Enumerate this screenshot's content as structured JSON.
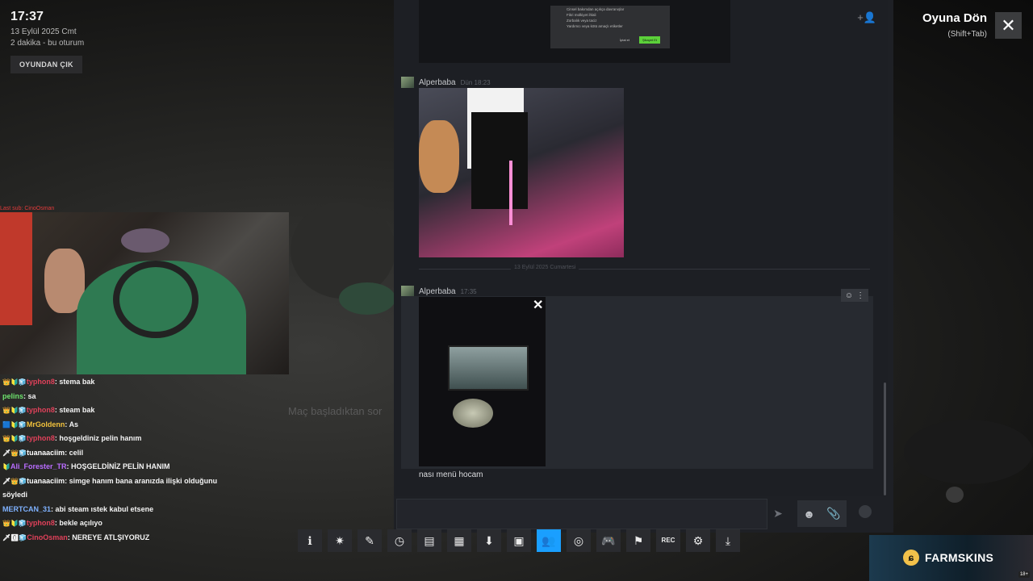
{
  "overlay": {
    "clock": "17:37",
    "date": "13 Eylül 2025 Cmt",
    "session": "2 dakika - bu oturum",
    "exit_label": "OYUNDAN ÇIK",
    "back_title": "Oyuna Dön",
    "back_hint": "(Shift+Tab)",
    "close_icon": "✕"
  },
  "stream": {
    "alert": "Last sub: CinoOsman",
    "ghost_text": "Maç başladıktan sor",
    "chat": [
      {
        "user": "typhon8",
        "color": "#e0415a",
        "badges": "👑🔰🧊",
        "text": "stema bak"
      },
      {
        "user": "pelins",
        "color": "#6de36d",
        "badges": "",
        "text": "sa"
      },
      {
        "user": "typhon8",
        "color": "#e0415a",
        "badges": "👑🔰🧊",
        "text": "steam bak"
      },
      {
        "user": "MrGoldenn",
        "color": "#f2c23c",
        "badges": "🟦🔰🧊",
        "text": "As"
      },
      {
        "user": "typhon8",
        "color": "#e0415a",
        "badges": "👑🔰🧊",
        "text": "hoşgeldiniz pelin hanım"
      },
      {
        "user": "tuanaaciim",
        "color": "#ffffff",
        "badges": "🗡👑🧊",
        "text": "celil"
      },
      {
        "user": "Ali_Forester_TR",
        "color": "#b96cff",
        "badges": "🔰",
        "text": "HOŞGELDİNİZ PELİN HANIM"
      },
      {
        "user": "tuanaaciim",
        "color": "#ffffff",
        "badges": "🗡👑🧊",
        "text": "simge hanım bana aranızda ilişki olduğunu söyledi"
      },
      {
        "user": "MERTCAN_31",
        "color": "#7fb2ff",
        "badges": "",
        "text": "abi steam ıstek kabul etsene"
      },
      {
        "user": "typhon8",
        "color": "#e0415a",
        "badges": "👑🔰🧊",
        "text": "bekle açılıyo"
      },
      {
        "user": "CinoOsman",
        "color": "#e0415a",
        "badges": "🗡🅾🧊",
        "text": "NEREYE ATLŞIYORUZ"
      }
    ]
  },
  "steam_chat": {
    "modal_lines": [
      "Cinsel bakımdan açıkça davranışlar",
      "Fikri mülkiyet ihlali",
      "Zorbalık veya taciz",
      "Yardımcı veya kötü amaçlı etiketler"
    ],
    "modal_cancel": "İptal et",
    "modal_submit": "Şikayet Et",
    "messages": [
      {
        "author": "Alperbaba",
        "time": "Dün 18:23"
      },
      {
        "author": "Alperbaba",
        "time": "17:35",
        "caption": "nası menü hocam"
      }
    ],
    "divider": "13 Eylül 2025 Cumartesi"
  },
  "toolbar": {
    "buttons": [
      "info",
      "achievements",
      "notes",
      "timer",
      "guide",
      "chat",
      "download",
      "screenshots",
      "friends",
      "browser",
      "controller",
      "flag",
      "REC",
      "settings",
      "dock"
    ],
    "active": "friends"
  },
  "ad": {
    "brand": "FARMSKINS",
    "age": "18+"
  }
}
